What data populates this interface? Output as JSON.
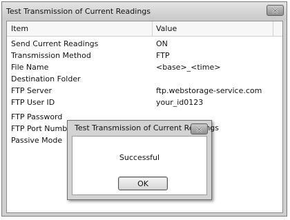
{
  "window": {
    "title": "Test Transmission of Current Readings",
    "close_icon": "close-icon"
  },
  "table": {
    "columns": [
      "Item",
      "Value"
    ],
    "rows": [
      {
        "item": "Send Current Readings",
        "value": "ON"
      },
      {
        "item": "Transmission Method",
        "value": "FTP"
      },
      {
        "item": "File Name",
        "value": "<base>_<time>"
      },
      {
        "item": "Destination Folder",
        "value": ""
      },
      {
        "item": "FTP Server",
        "value": "ftp.webstorage-service.com"
      },
      {
        "item": "FTP User ID",
        "value": "your_id0123"
      },
      {
        "item": "FTP Password",
        "value": ""
      },
      {
        "item": "FTP Port Number",
        "value": ""
      },
      {
        "item": "Passive Mode",
        "value": ""
      }
    ]
  },
  "dialog": {
    "title": "Test Transmission of Current Readings",
    "message": "Successful",
    "ok_label": "OK",
    "close_icon": "close-icon"
  }
}
